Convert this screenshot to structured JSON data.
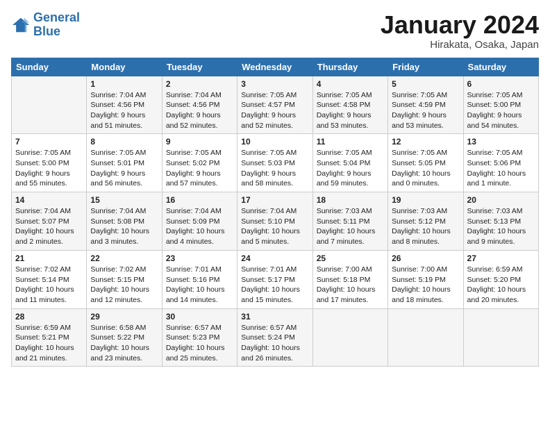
{
  "header": {
    "logo_line1": "General",
    "logo_line2": "Blue",
    "month": "January 2024",
    "location": "Hirakata, Osaka, Japan"
  },
  "days_of_week": [
    "Sunday",
    "Monday",
    "Tuesday",
    "Wednesday",
    "Thursday",
    "Friday",
    "Saturday"
  ],
  "weeks": [
    [
      {
        "num": "",
        "sunrise": "",
        "sunset": "",
        "daylight": ""
      },
      {
        "num": "1",
        "sunrise": "Sunrise: 7:04 AM",
        "sunset": "Sunset: 4:56 PM",
        "daylight": "Daylight: 9 hours and 51 minutes."
      },
      {
        "num": "2",
        "sunrise": "Sunrise: 7:04 AM",
        "sunset": "Sunset: 4:56 PM",
        "daylight": "Daylight: 9 hours and 52 minutes."
      },
      {
        "num": "3",
        "sunrise": "Sunrise: 7:05 AM",
        "sunset": "Sunset: 4:57 PM",
        "daylight": "Daylight: 9 hours and 52 minutes."
      },
      {
        "num": "4",
        "sunrise": "Sunrise: 7:05 AM",
        "sunset": "Sunset: 4:58 PM",
        "daylight": "Daylight: 9 hours and 53 minutes."
      },
      {
        "num": "5",
        "sunrise": "Sunrise: 7:05 AM",
        "sunset": "Sunset: 4:59 PM",
        "daylight": "Daylight: 9 hours and 53 minutes."
      },
      {
        "num": "6",
        "sunrise": "Sunrise: 7:05 AM",
        "sunset": "Sunset: 5:00 PM",
        "daylight": "Daylight: 9 hours and 54 minutes."
      }
    ],
    [
      {
        "num": "7",
        "sunrise": "Sunrise: 7:05 AM",
        "sunset": "Sunset: 5:00 PM",
        "daylight": "Daylight: 9 hours and 55 minutes."
      },
      {
        "num": "8",
        "sunrise": "Sunrise: 7:05 AM",
        "sunset": "Sunset: 5:01 PM",
        "daylight": "Daylight: 9 hours and 56 minutes."
      },
      {
        "num": "9",
        "sunrise": "Sunrise: 7:05 AM",
        "sunset": "Sunset: 5:02 PM",
        "daylight": "Daylight: 9 hours and 57 minutes."
      },
      {
        "num": "10",
        "sunrise": "Sunrise: 7:05 AM",
        "sunset": "Sunset: 5:03 PM",
        "daylight": "Daylight: 9 hours and 58 minutes."
      },
      {
        "num": "11",
        "sunrise": "Sunrise: 7:05 AM",
        "sunset": "Sunset: 5:04 PM",
        "daylight": "Daylight: 9 hours and 59 minutes."
      },
      {
        "num": "12",
        "sunrise": "Sunrise: 7:05 AM",
        "sunset": "Sunset: 5:05 PM",
        "daylight": "Daylight: 10 hours and 0 minutes."
      },
      {
        "num": "13",
        "sunrise": "Sunrise: 7:05 AM",
        "sunset": "Sunset: 5:06 PM",
        "daylight": "Daylight: 10 hours and 1 minute."
      }
    ],
    [
      {
        "num": "14",
        "sunrise": "Sunrise: 7:04 AM",
        "sunset": "Sunset: 5:07 PM",
        "daylight": "Daylight: 10 hours and 2 minutes."
      },
      {
        "num": "15",
        "sunrise": "Sunrise: 7:04 AM",
        "sunset": "Sunset: 5:08 PM",
        "daylight": "Daylight: 10 hours and 3 minutes."
      },
      {
        "num": "16",
        "sunrise": "Sunrise: 7:04 AM",
        "sunset": "Sunset: 5:09 PM",
        "daylight": "Daylight: 10 hours and 4 minutes."
      },
      {
        "num": "17",
        "sunrise": "Sunrise: 7:04 AM",
        "sunset": "Sunset: 5:10 PM",
        "daylight": "Daylight: 10 hours and 5 minutes."
      },
      {
        "num": "18",
        "sunrise": "Sunrise: 7:03 AM",
        "sunset": "Sunset: 5:11 PM",
        "daylight": "Daylight: 10 hours and 7 minutes."
      },
      {
        "num": "19",
        "sunrise": "Sunrise: 7:03 AM",
        "sunset": "Sunset: 5:12 PM",
        "daylight": "Daylight: 10 hours and 8 minutes."
      },
      {
        "num": "20",
        "sunrise": "Sunrise: 7:03 AM",
        "sunset": "Sunset: 5:13 PM",
        "daylight": "Daylight: 10 hours and 9 minutes."
      }
    ],
    [
      {
        "num": "21",
        "sunrise": "Sunrise: 7:02 AM",
        "sunset": "Sunset: 5:14 PM",
        "daylight": "Daylight: 10 hours and 11 minutes."
      },
      {
        "num": "22",
        "sunrise": "Sunrise: 7:02 AM",
        "sunset": "Sunset: 5:15 PM",
        "daylight": "Daylight: 10 hours and 12 minutes."
      },
      {
        "num": "23",
        "sunrise": "Sunrise: 7:01 AM",
        "sunset": "Sunset: 5:16 PM",
        "daylight": "Daylight: 10 hours and 14 minutes."
      },
      {
        "num": "24",
        "sunrise": "Sunrise: 7:01 AM",
        "sunset": "Sunset: 5:17 PM",
        "daylight": "Daylight: 10 hours and 15 minutes."
      },
      {
        "num": "25",
        "sunrise": "Sunrise: 7:00 AM",
        "sunset": "Sunset: 5:18 PM",
        "daylight": "Daylight: 10 hours and 17 minutes."
      },
      {
        "num": "26",
        "sunrise": "Sunrise: 7:00 AM",
        "sunset": "Sunset: 5:19 PM",
        "daylight": "Daylight: 10 hours and 18 minutes."
      },
      {
        "num": "27",
        "sunrise": "Sunrise: 6:59 AM",
        "sunset": "Sunset: 5:20 PM",
        "daylight": "Daylight: 10 hours and 20 minutes."
      }
    ],
    [
      {
        "num": "28",
        "sunrise": "Sunrise: 6:59 AM",
        "sunset": "Sunset: 5:21 PM",
        "daylight": "Daylight: 10 hours and 21 minutes."
      },
      {
        "num": "29",
        "sunrise": "Sunrise: 6:58 AM",
        "sunset": "Sunset: 5:22 PM",
        "daylight": "Daylight: 10 hours and 23 minutes."
      },
      {
        "num": "30",
        "sunrise": "Sunrise: 6:57 AM",
        "sunset": "Sunset: 5:23 PM",
        "daylight": "Daylight: 10 hours and 25 minutes."
      },
      {
        "num": "31",
        "sunrise": "Sunrise: 6:57 AM",
        "sunset": "Sunset: 5:24 PM",
        "daylight": "Daylight: 10 hours and 26 minutes."
      },
      {
        "num": "",
        "sunrise": "",
        "sunset": "",
        "daylight": ""
      },
      {
        "num": "",
        "sunrise": "",
        "sunset": "",
        "daylight": ""
      },
      {
        "num": "",
        "sunrise": "",
        "sunset": "",
        "daylight": ""
      }
    ]
  ]
}
